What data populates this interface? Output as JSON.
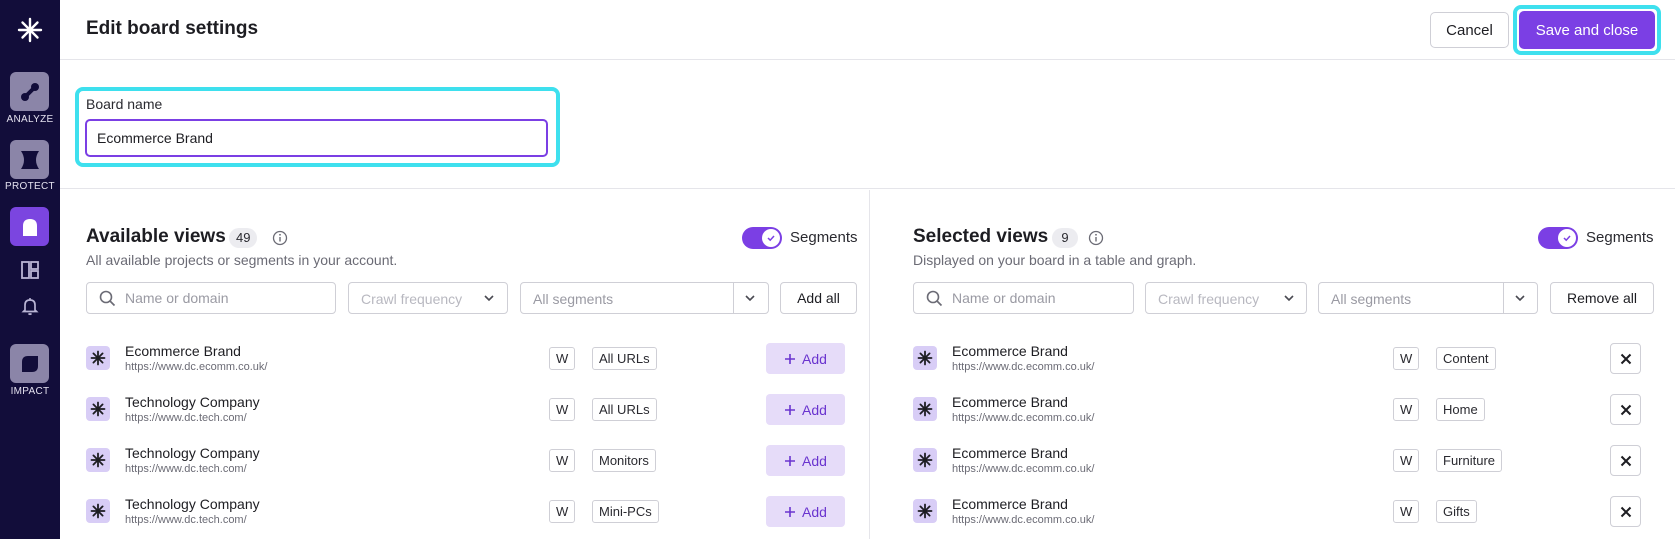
{
  "rail": {
    "items": [
      {
        "label": "ANALYZE",
        "icon": "analyze-icon"
      },
      {
        "label": "PROTECT",
        "icon": "protect-icon"
      },
      {
        "label": "",
        "icon": "board-icon"
      },
      {
        "label": "",
        "icon": "dashboard-grid-icon"
      },
      {
        "label": "",
        "icon": "bell-icon"
      },
      {
        "label": "IMPACT",
        "icon": "impact-icon"
      }
    ]
  },
  "header": {
    "title": "Edit board settings",
    "cancel_label": "Cancel",
    "save_label": "Save and close"
  },
  "board_name": {
    "label": "Board name",
    "value": "Ecommerce Brand"
  },
  "available": {
    "title": "Available views",
    "count": "49",
    "subtitle": "All available projects or segments in your account.",
    "toggle_label": "Segments",
    "search_placeholder": "Name or domain",
    "crawl_placeholder": "Crawl frequency",
    "segments_placeholder": "All segments",
    "action_label": "Add all",
    "add_label": "Add",
    "rows": [
      {
        "name": "Ecommerce Brand",
        "url": "https://www.dc.ecomm.co.uk/",
        "freq": "W",
        "segment": "All URLs"
      },
      {
        "name": "Technology Company",
        "url": "https://www.dc.tech.com/",
        "freq": "W",
        "segment": "All URLs"
      },
      {
        "name": "Technology Company",
        "url": "https://www.dc.tech.com/",
        "freq": "W",
        "segment": "Monitors"
      },
      {
        "name": "Technology Company",
        "url": "https://www.dc.tech.com/",
        "freq": "W",
        "segment": "Mini-PCs"
      }
    ]
  },
  "selected": {
    "title": "Selected views",
    "count": "9",
    "subtitle": "Displayed on your board in a table and graph.",
    "toggle_label": "Segments",
    "search_placeholder": "Name or domain",
    "crawl_placeholder": "Crawl frequency",
    "segments_placeholder": "All segments",
    "action_label": "Remove all",
    "rows": [
      {
        "name": "Ecommerce Brand",
        "url": "https://www.dc.ecomm.co.uk/",
        "freq": "W",
        "segment": "Content"
      },
      {
        "name": "Ecommerce Brand",
        "url": "https://www.dc.ecomm.co.uk/",
        "freq": "W",
        "segment": "Home"
      },
      {
        "name": "Ecommerce Brand",
        "url": "https://www.dc.ecomm.co.uk/",
        "freq": "W",
        "segment": "Furniture"
      },
      {
        "name": "Ecommerce Brand",
        "url": "https://www.dc.ecomm.co.uk/",
        "freq": "W",
        "segment": "Gifts"
      }
    ]
  },
  "colors": {
    "accent": "#7b3fe4",
    "highlight": "#3ee0ee",
    "rail": "#120d3a"
  }
}
